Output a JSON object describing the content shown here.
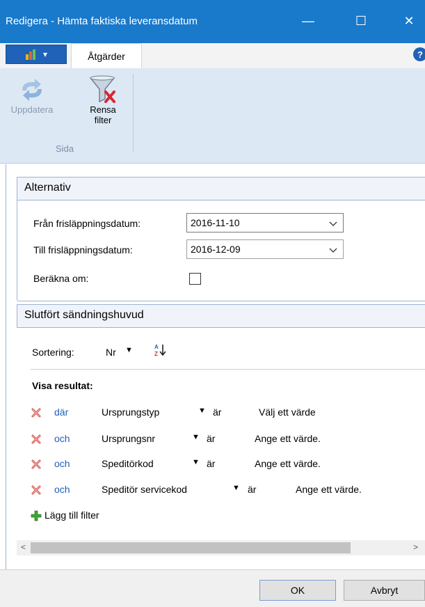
{
  "window": {
    "title": "Redigera - Hämta faktiska leveransdatum",
    "minimize_glyph": "—",
    "maximize_glyph": "☐",
    "close_glyph": "✕"
  },
  "ribbon": {
    "app_menu_label": "▾",
    "tab_label": "Åtgärder",
    "help_glyph": "?",
    "buttons": [
      {
        "label": "Uppdatera",
        "icon": "refresh-icon",
        "enabled": false
      },
      {
        "label": "Rensa filter",
        "icon": "clear-filter-icon",
        "enabled": true
      }
    ],
    "group_label": "Sida"
  },
  "alternativ": {
    "header": "Alternativ",
    "from_label": "Från frisläppningsdatum:",
    "from_value": "2016-11-10",
    "to_label": "Till frisläppningsdatum:",
    "to_value": "2016-12-09",
    "recalc_label": "Beräkna om:",
    "recalc_checked": false
  },
  "shipment": {
    "header": "Slutfört sändningshuvud",
    "sort_label": "Sortering:",
    "sort_value": "Nr",
    "sort_dropdown_glyph": "▼",
    "show_results_label": "Visa resultat:",
    "filters": [
      {
        "conj": "där",
        "field": "Ursprungstyp",
        "op": "är",
        "value": "Välj ett värde"
      },
      {
        "conj": "och",
        "field": "Ursprungsnr",
        "op": "är",
        "value": "Ange ett värde."
      },
      {
        "conj": "och",
        "field": "Speditörkod",
        "op": "är",
        "value": "Ange ett värde."
      },
      {
        "conj": "och",
        "field": "Speditör servicekod",
        "op": "är",
        "value": "Ange ett värde."
      }
    ],
    "add_filter_label": "Lägg till filter"
  },
  "footer": {
    "ok_label": "OK",
    "cancel_label": "Avbryt"
  },
  "colors": {
    "titlebar": "#1979ca",
    "ribbon": "#dde8f5",
    "link_blue": "#1f5fbf",
    "delete_red": "#d9534f",
    "add_green": "#3fa535"
  }
}
